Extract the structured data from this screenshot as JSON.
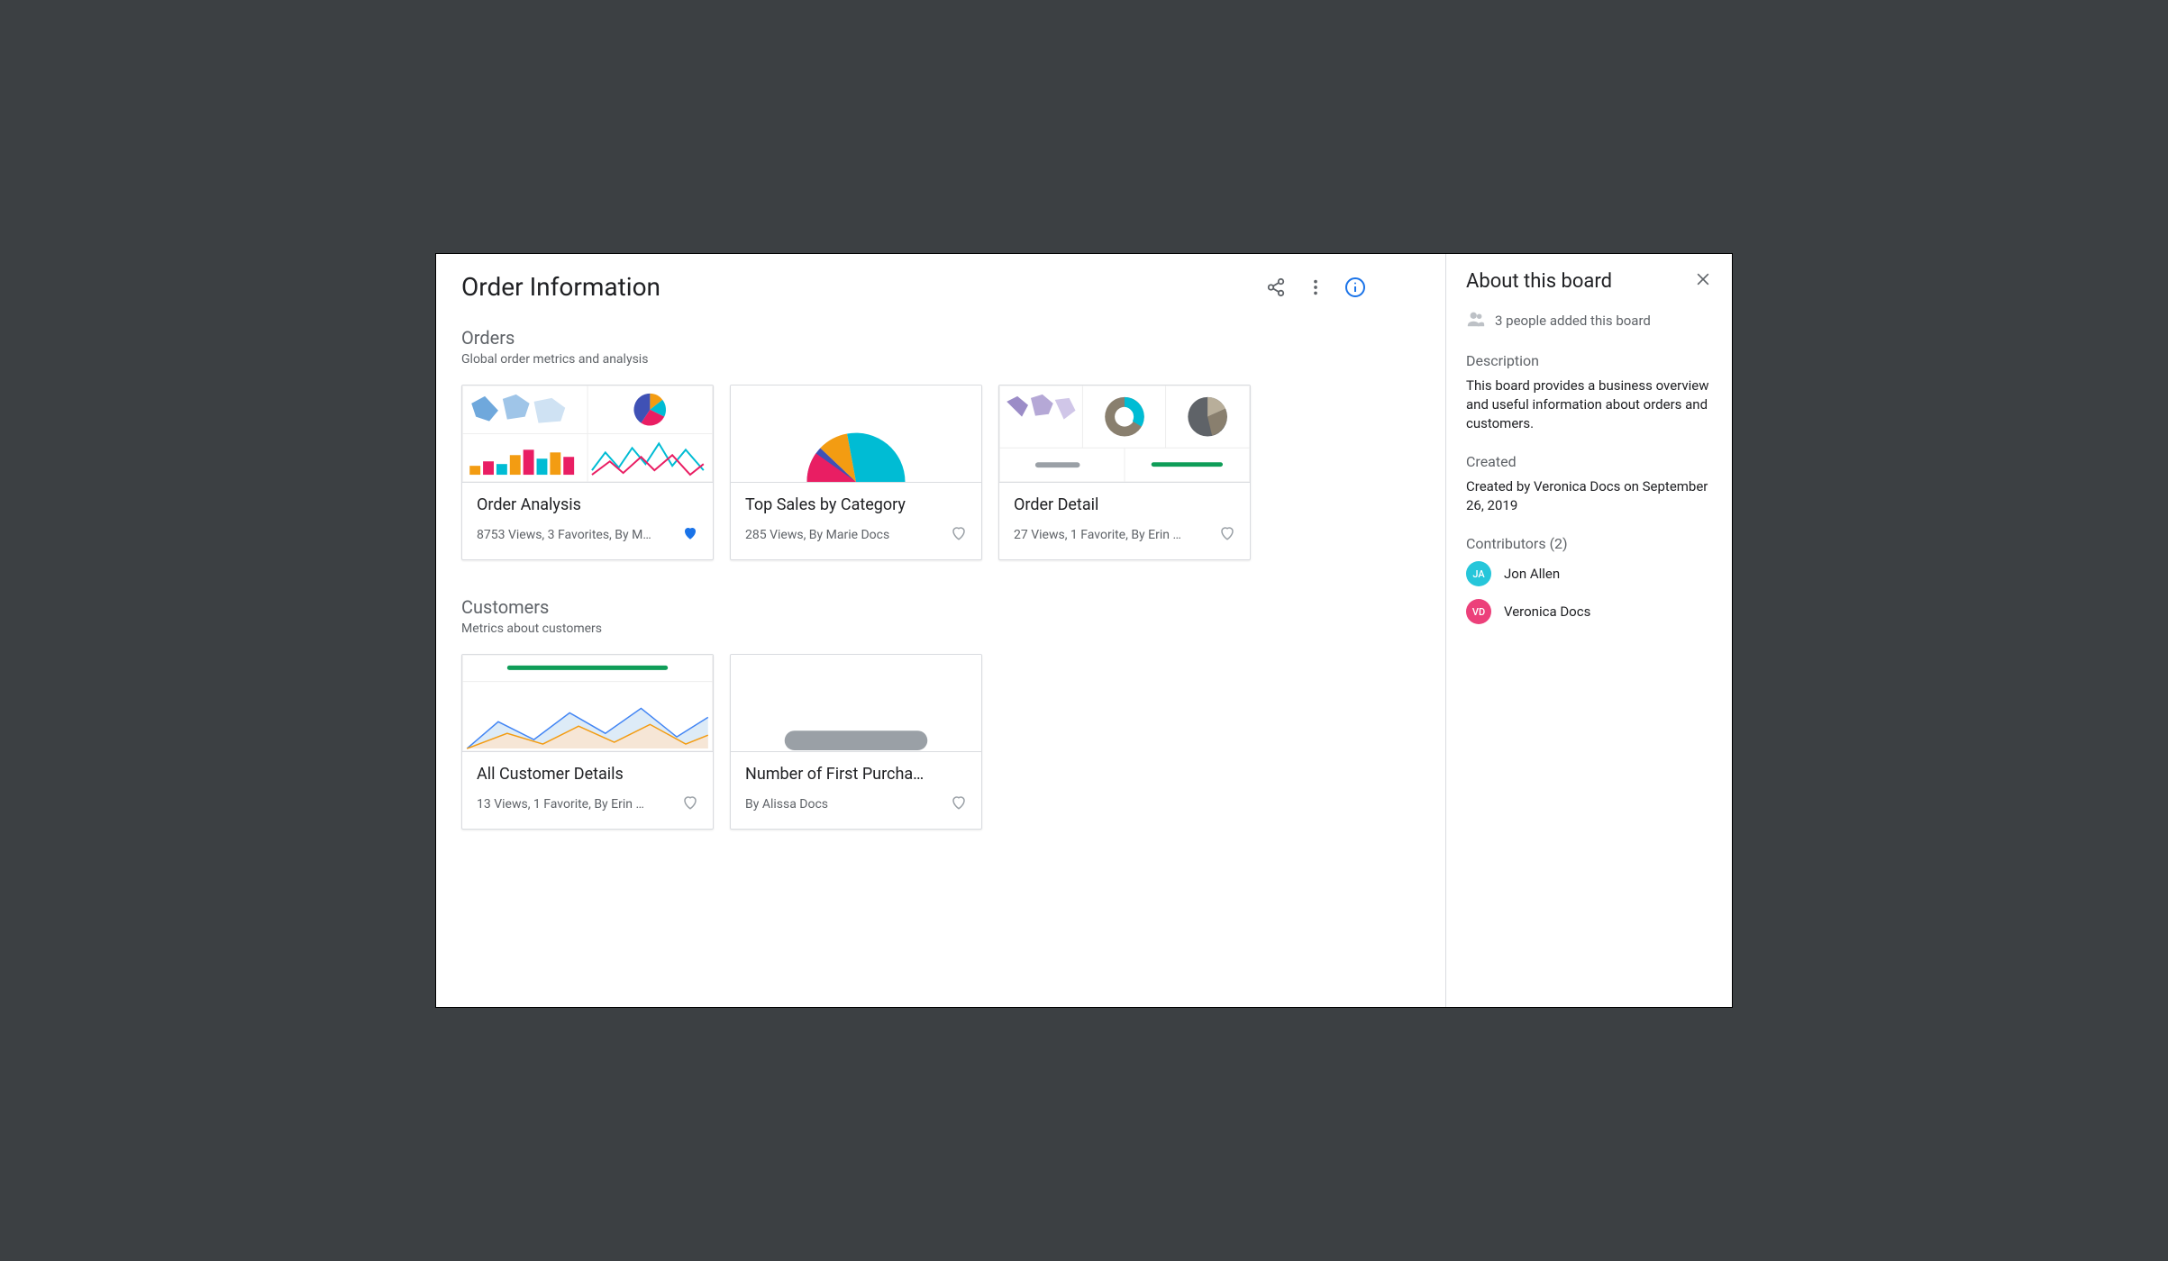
{
  "page_title": "Order Information",
  "sections": [
    {
      "title": "Orders",
      "subtitle": "Global order metrics and analysis",
      "cards": [
        {
          "title": "Order Analysis",
          "meta": "8753 Views, 3 Favorites, By M…",
          "favorited": true
        },
        {
          "title": "Top Sales by Category",
          "meta": "285 Views, By Marie Docs",
          "favorited": false
        },
        {
          "title": "Order Detail",
          "meta": "27 Views, 1 Favorite, By Erin …",
          "favorited": false
        }
      ]
    },
    {
      "title": "Customers",
      "subtitle": "Metrics about customers",
      "cards": [
        {
          "title": "All Customer Details",
          "meta": "13 Views, 1 Favorite, By Erin …",
          "favorited": false
        },
        {
          "title": "Number of First Purcha…",
          "meta": "By Alissa Docs",
          "favorited": false
        }
      ]
    }
  ],
  "sidebar": {
    "title": "About this board",
    "people_count": "3 people added this board",
    "description_label": "Description",
    "description_text": "This board provides a business overview and useful information about orders and customers.",
    "created_label": "Created",
    "created_text": "Created by Veronica Docs on September 26, 2019",
    "contributors_label": "Contributors (2)",
    "contributors": [
      {
        "initials": "JA",
        "name": "Jon Allen",
        "class": "ja"
      },
      {
        "initials": "VD",
        "name": "Veronica Docs",
        "class": "vd"
      }
    ]
  }
}
